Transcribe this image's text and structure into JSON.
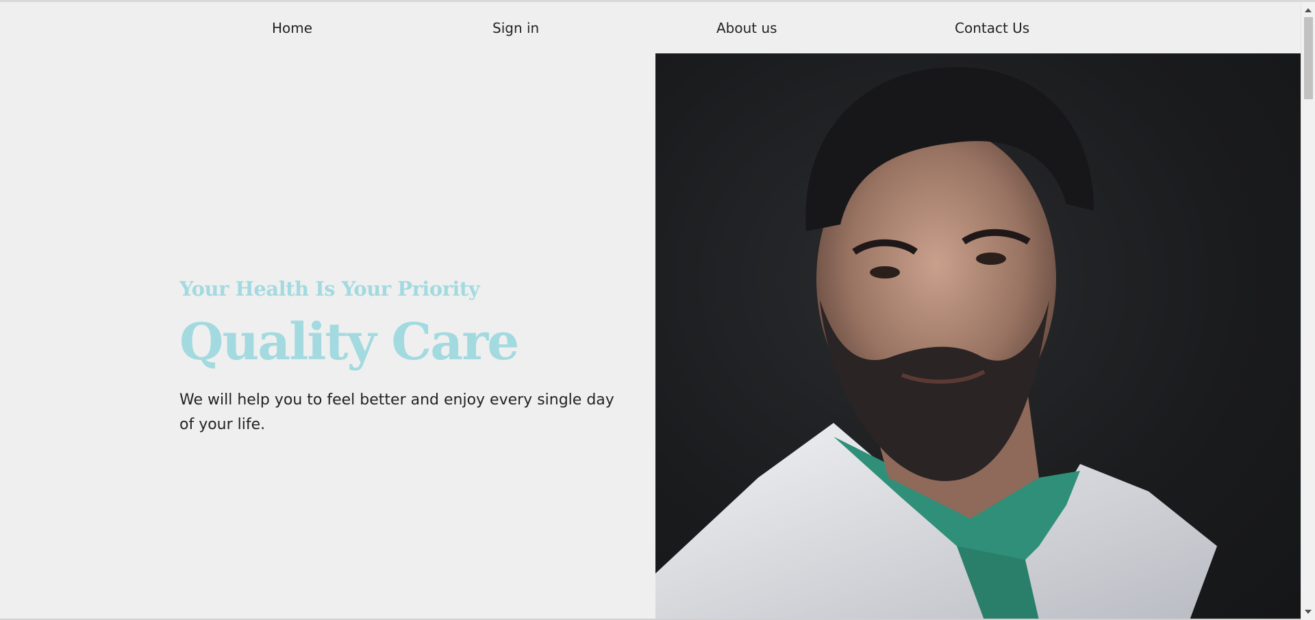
{
  "nav": {
    "items": [
      {
        "label": "Home"
      },
      {
        "label": "Sign in"
      },
      {
        "label": "About us"
      },
      {
        "label": "Contact Us"
      }
    ]
  },
  "hero": {
    "subtitle": "Your Health Is Your Priority",
    "headline": "Quality Care",
    "description": "We will help you to feel better and enjoy every single day of your life.",
    "image": {
      "subject": "smiling bearded doctor in white coat"
    }
  },
  "colors": {
    "accent": "#a2dae0",
    "background": "#efefef",
    "text": "#222222"
  }
}
